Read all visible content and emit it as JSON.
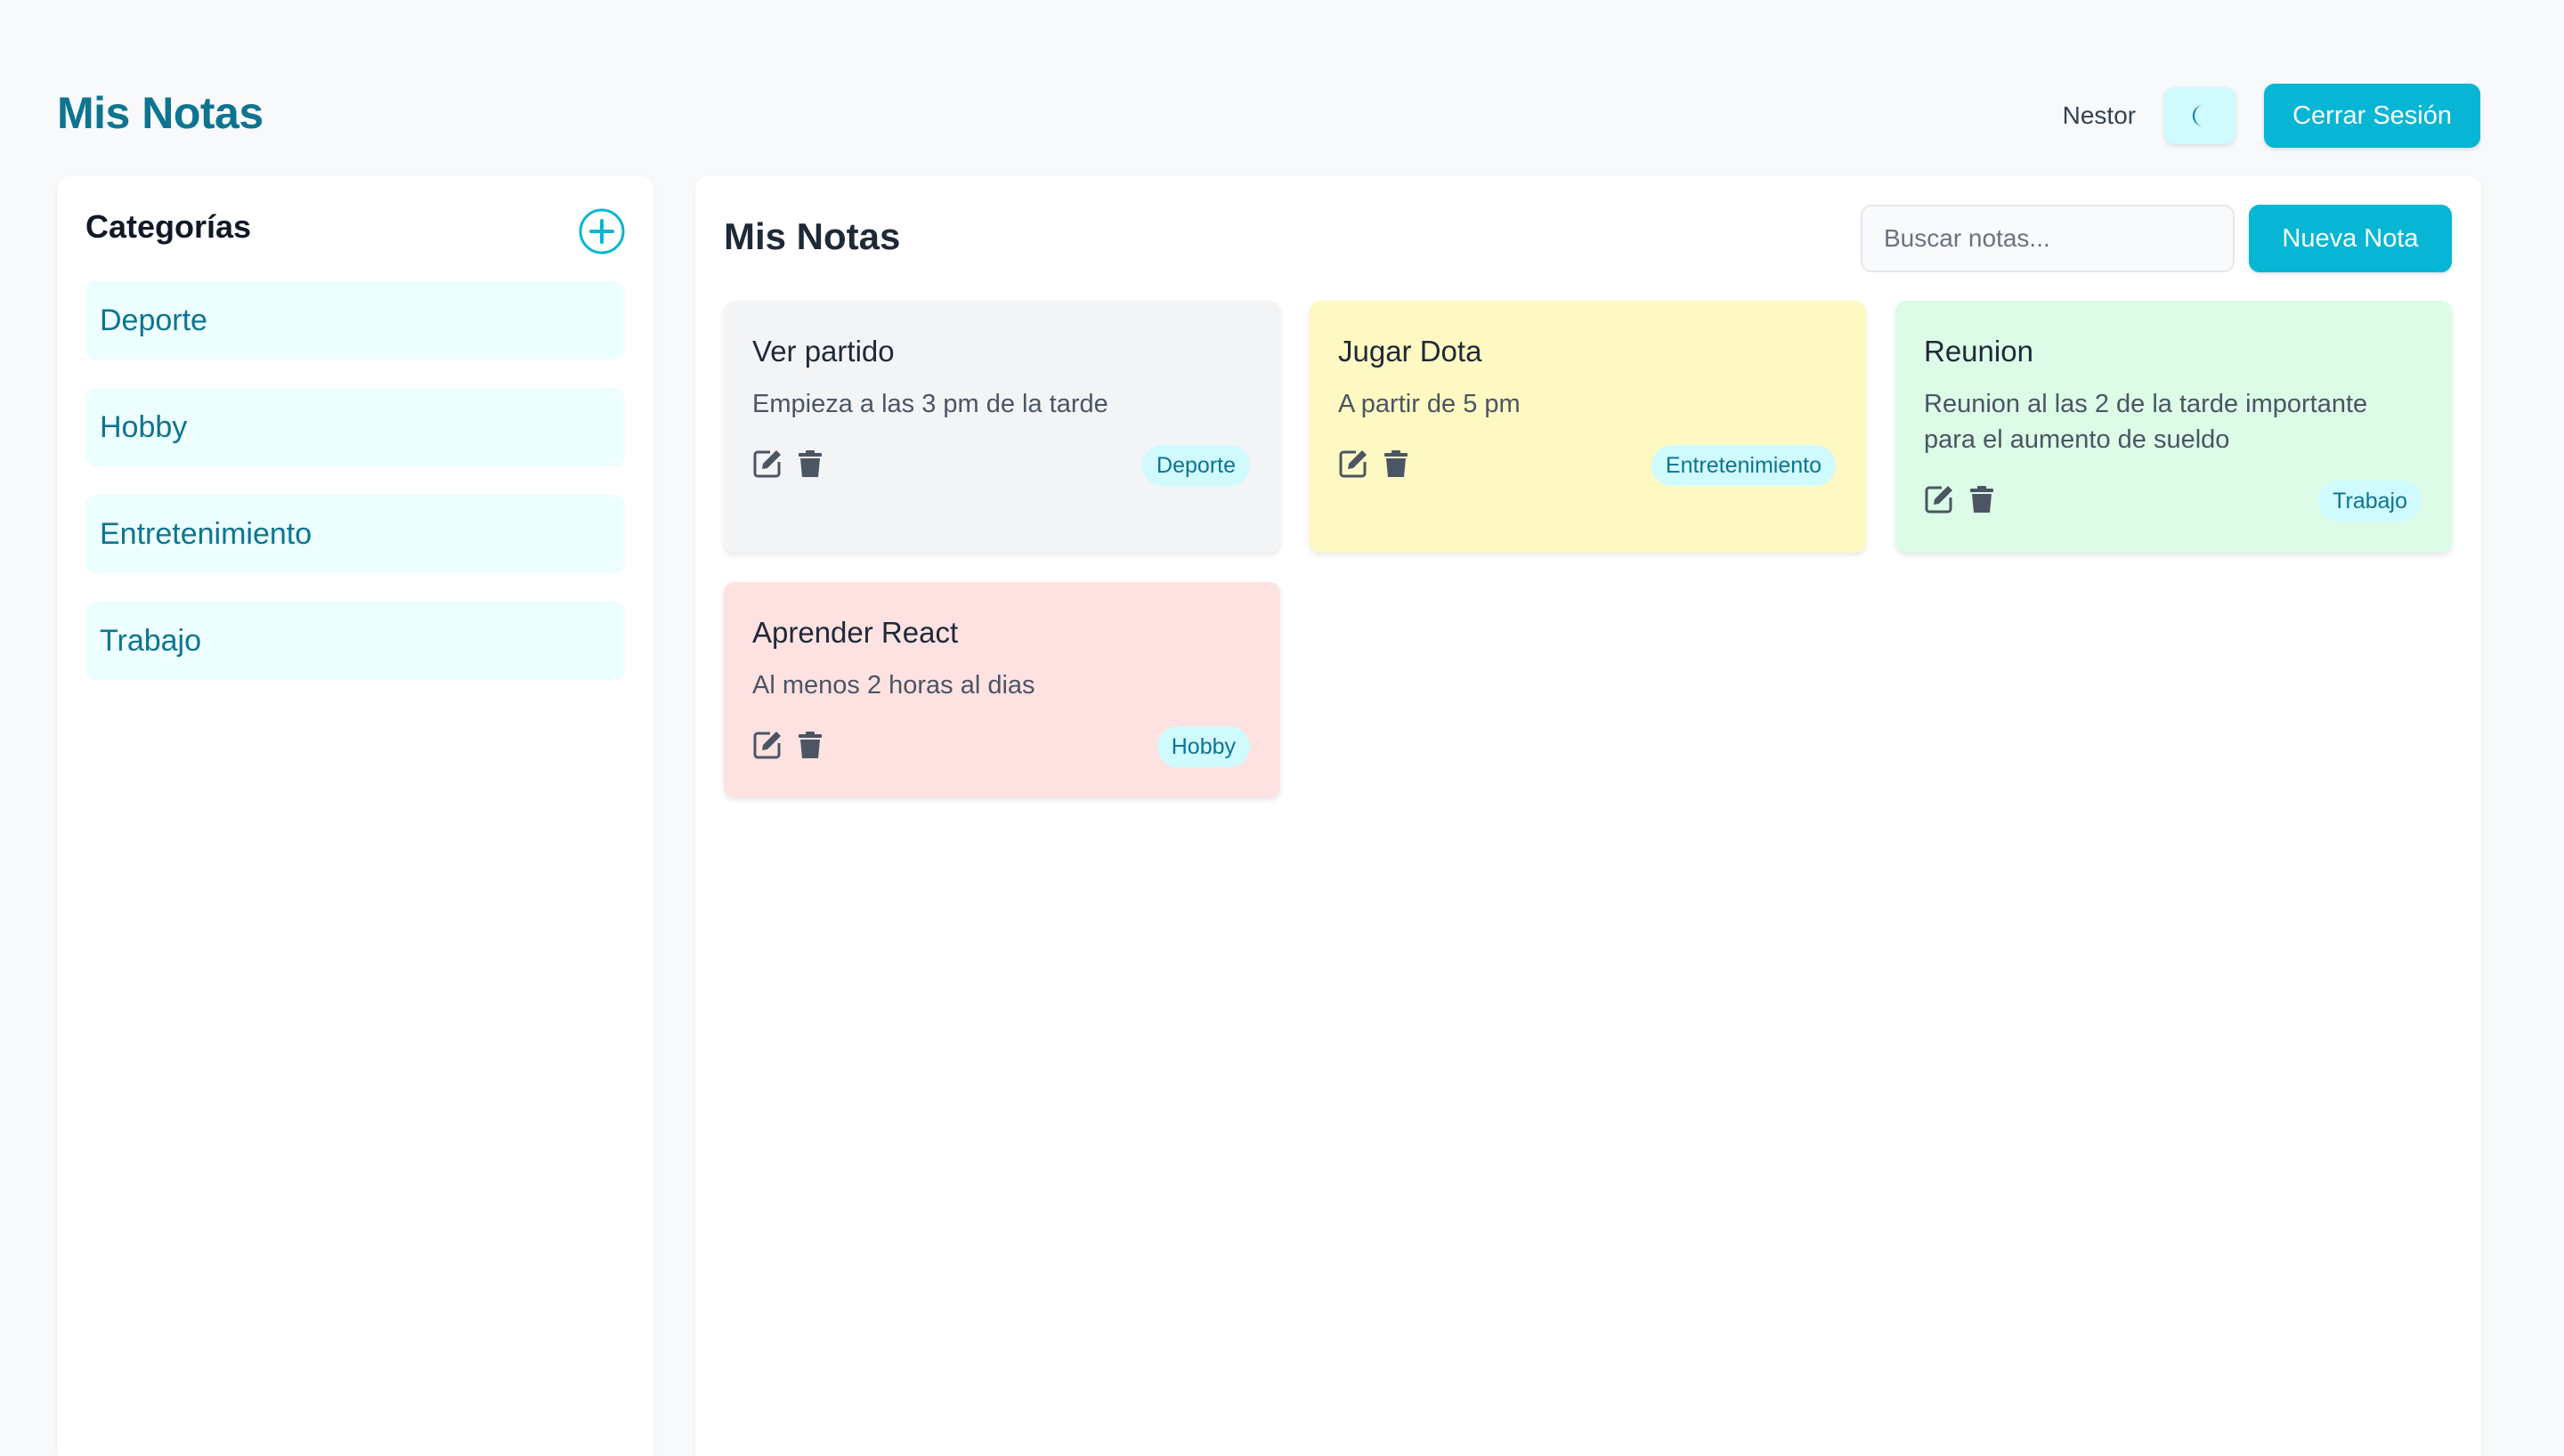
{
  "header": {
    "app_title": "Mis Notas",
    "username": "Nestor",
    "theme_icon": "moon-icon",
    "logout_label": "Cerrar Sesión"
  },
  "sidebar": {
    "title": "Categorías",
    "add_icon": "plus-circle-icon",
    "categories": [
      {
        "label": "Deporte"
      },
      {
        "label": "Hobby"
      },
      {
        "label": "Entretenimiento"
      },
      {
        "label": "Trabajo"
      }
    ]
  },
  "main": {
    "title": "Mis Notas",
    "search_placeholder": "Buscar notas...",
    "search_value": "",
    "new_note_label": "Nueva Nota"
  },
  "notes": [
    {
      "title": "Ver partido",
      "content": "Empieza a las 3 pm de la tarde",
      "category": "Deporte",
      "color": "#f3f4f6"
    },
    {
      "title": "Jugar Dota",
      "content": "A partir de 5 pm",
      "category": "Entretenimiento",
      "color": "#fef9c3"
    },
    {
      "title": "Reunion",
      "content": "Reunion al las 2 de la tarde importante para el aumento de sueldo",
      "category": "Trabajo",
      "color": "#dcfce7"
    },
    {
      "title": "Aprender React",
      "content": "Al menos 2 horas al dias",
      "category": "Hobby",
      "color": "#fee2e2"
    }
  ],
  "note_action_icons": {
    "edit": "edit-icon",
    "delete": "trash-icon"
  },
  "colors": {
    "accent": "#06b6d4",
    "accent_dark": "#0e7490",
    "category_bg": "#ecfeff",
    "badge_bg": "#cffafe"
  }
}
